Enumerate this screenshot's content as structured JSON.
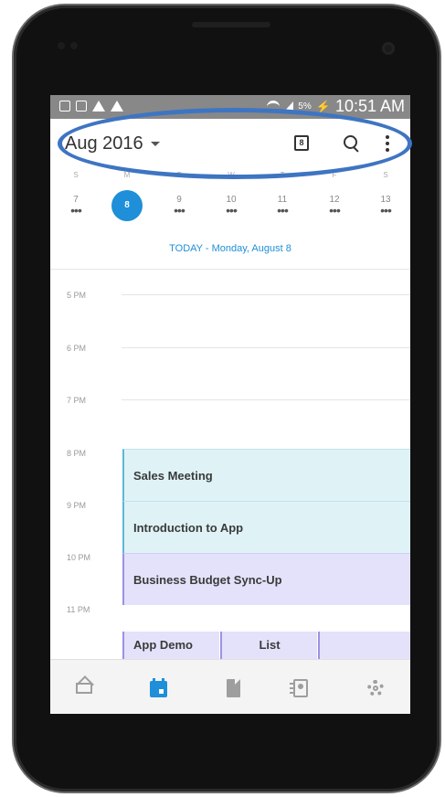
{
  "status_bar": {
    "time": "10:51 AM",
    "battery_percent": "5%"
  },
  "header": {
    "month_label": "Aug 2016"
  },
  "week": {
    "day_letters": [
      "S",
      "M",
      "T",
      "W",
      "T",
      "F",
      "S"
    ],
    "day_numbers": [
      "7",
      "8",
      "9",
      "10",
      "11",
      "12",
      "13"
    ],
    "selected_day": "8",
    "event_dots": "•••"
  },
  "today_label": "TODAY - Monday, August 8",
  "hours": [
    "5 PM",
    "6 PM",
    "7 PM",
    "8 PM",
    "9 PM",
    "10 PM",
    "11 PM"
  ],
  "events": {
    "sales_meeting": "Sales Meeting",
    "introduction": "Introduction to App",
    "budget": "Business Budget Sync-Up",
    "app_demo": "App Demo",
    "list": "List"
  },
  "fab_label": "+",
  "colors": {
    "accent": "#1e8fd8",
    "event_teal": "#dff3f7",
    "event_purple": "#e3e2fa",
    "highlight_ring": "#3e75c2"
  },
  "icons": {
    "header": [
      "calendar-icon",
      "search-icon",
      "more-icon"
    ],
    "bottom_nav": [
      "mail-icon",
      "calendar-icon",
      "file-icon",
      "contacts-icon",
      "settings-icon"
    ]
  }
}
